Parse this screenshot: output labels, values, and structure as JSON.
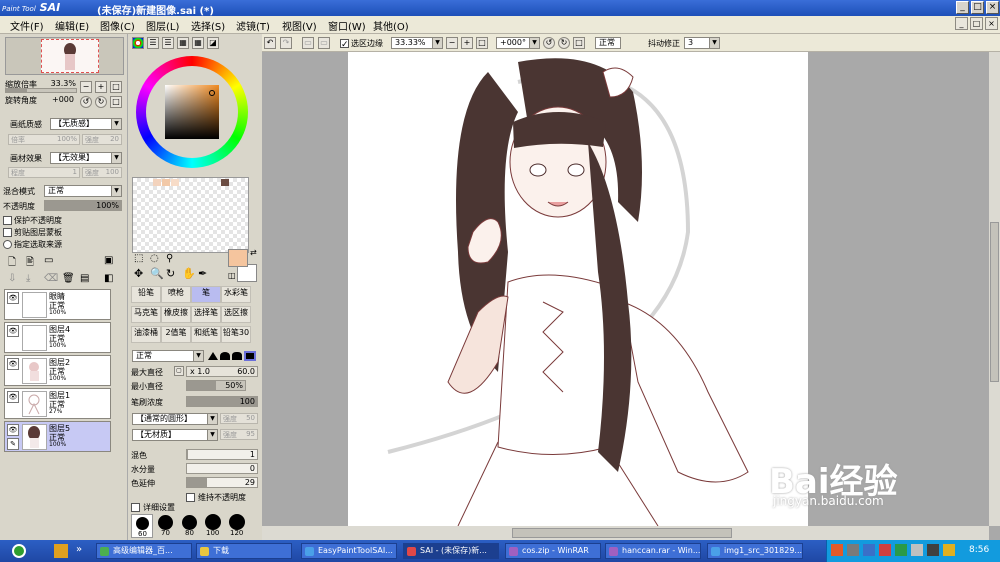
{
  "window": {
    "app_logo_small": "Paint Tool",
    "app_logo_big": "SAI",
    "title": "(未保存)新建图像.sai (*)",
    "buttons": [
      "_",
      "□",
      "×"
    ]
  },
  "menu": {
    "items": [
      "文件(F)",
      "编辑(E)",
      "图像(C)",
      "图层(L)",
      "选择(S)",
      "滤镜(T)",
      "视图(V)",
      "窗口(W)",
      "其他(O)"
    ],
    "right_buttons": [
      "_",
      "□",
      "×"
    ]
  },
  "navigator": {
    "zoom_label": "缩放倍率",
    "zoom_value": "33.3%",
    "rotate_label": "旋转角度",
    "rotate_value": "+000",
    "button_minus": "−",
    "button_plus": "+",
    "button_reset": "□"
  },
  "paper_texture": {
    "label": "画纸质感",
    "value": "【无质感】",
    "scale_label": "倍率",
    "scale_value": "100%",
    "strength_label": "强度",
    "strength_value": "20"
  },
  "paper_effect": {
    "label": "画材效果",
    "value": "【无效果】",
    "degree_label": "程度",
    "degree_value": "1",
    "strength_label": "强度",
    "strength_value": "100"
  },
  "layer_props": {
    "blend_label": "混合模式",
    "blend_value": "正常",
    "opacity_label": "不透明度",
    "opacity_value": "100%",
    "checkboxes": [
      "保护不透明度",
      "剪贴图层蒙板",
      "指定选取来源"
    ]
  },
  "layers": [
    {
      "name": "眼睛",
      "mode": "正常",
      "opacity": "100%",
      "selected": false
    },
    {
      "name": "图层4",
      "mode": "正常",
      "opacity": "100%",
      "selected": false
    },
    {
      "name": "图层2",
      "mode": "正常",
      "opacity": "100%",
      "selected": false
    },
    {
      "name": "图层1",
      "mode": "正常",
      "opacity": "27%",
      "selected": false
    },
    {
      "name": "图层5",
      "mode": "正常",
      "opacity": "100%",
      "selected": true
    }
  ],
  "color": {
    "primary": "#f5c59e",
    "secondary": "#ffffff",
    "swatches": [
      "#f3d3bd",
      "#f2c9a8",
      "#f7dcc8",
      "#6b4d43"
    ]
  },
  "tools": {
    "rows": [
      [
        "铅笔",
        "喷枪",
        "笔",
        "水彩笔"
      ],
      [
        "马克笔",
        "橡皮擦",
        "选择笔",
        "选区擦"
      ],
      [
        "油漆桶",
        "2值笔",
        "和纸笔",
        "铅笔30"
      ]
    ],
    "selected": "笔"
  },
  "brush": {
    "mode_value": "正常",
    "max_size_label": "最大直径",
    "max_size_multiplier": "x 1.0",
    "max_size_value": "60.0",
    "min_size_label": "最小直径",
    "min_size_value": "50%",
    "density_label": "笔刷浓度",
    "density_value": "100",
    "shape_value": "【通常的圆形】",
    "shape_strength_label": "强度",
    "shape_strength_value": "50",
    "texture_value": "【无材质】",
    "texture_strength_label": "强度",
    "texture_strength_value": "95",
    "blend_label": "混色",
    "blend_value": "1",
    "dilution_label": "水分量",
    "dilution_value": "0",
    "persistence_label": "色延伸",
    "persistence_value": "29",
    "keep_opacity_label": "维持不透明度",
    "detail_label": "详细设置",
    "size_presets": [
      "60",
      "70",
      "80",
      "100",
      "120"
    ]
  },
  "canvas_toolbar": {
    "selection_edge_label": "选区边缘",
    "zoom_value": "33.33%",
    "rotate_value": "+000°",
    "mode_value": "正常",
    "stabilizer_label": "抖动修正",
    "stabilizer_value": "3"
  },
  "taskbar": {
    "tasks": [
      {
        "label": "高级编辑器_百...",
        "color": "#4caf50",
        "active": false
      },
      {
        "label": "下载",
        "color": "#e8c640",
        "active": false
      },
      {
        "label": "EasyPaintToolSAI...",
        "color": "#4aa0e8",
        "active": false
      },
      {
        "label": "SAI - (未保存)新...",
        "color": "#e04848",
        "active": true
      },
      {
        "label": "cos.zip - WinRAR",
        "color": "#a060c0",
        "active": false
      },
      {
        "label": "hanccan.rar - Win...",
        "color": "#a060c0",
        "active": false
      },
      {
        "label": "img1_src_301829...",
        "color": "#4aa0e8",
        "active": false
      }
    ],
    "clock": "8:56"
  },
  "watermark": {
    "text": "Bai经验",
    "url": "jingyan.baidu.com"
  }
}
